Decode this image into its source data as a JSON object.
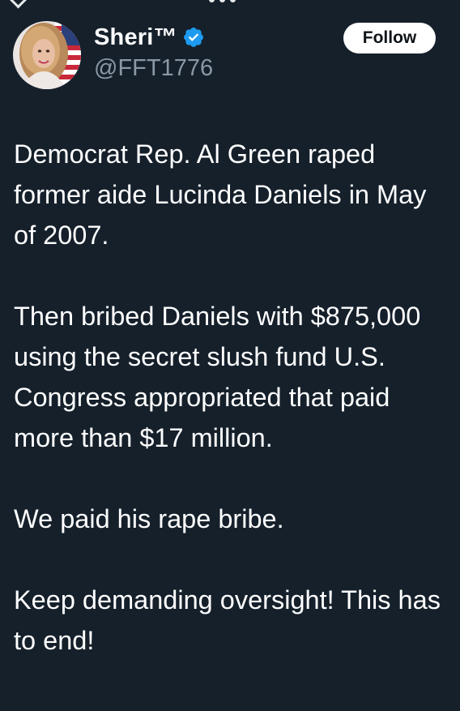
{
  "author": {
    "display_name": "Sheri™",
    "handle": "@FFT1776",
    "verified": true,
    "avatar_icon": "profile-photo"
  },
  "actions": {
    "follow_label": "Follow"
  },
  "tweet": {
    "paragraphs": [
      "Democrat Rep. Al Green raped former aide Lucinda Daniels in May of 2007.",
      "Then bribed Daniels with $875,000 using the secret slush fund U.S. Congress appropriated that paid more than $17 million.",
      "We paid his rape bribe.",
      "Keep demanding oversight! This has to end!"
    ]
  },
  "colors": {
    "background": "#15202b",
    "text": "#ffffff",
    "secondary_text": "#8b98a5",
    "verified": "#1d9bf0"
  }
}
